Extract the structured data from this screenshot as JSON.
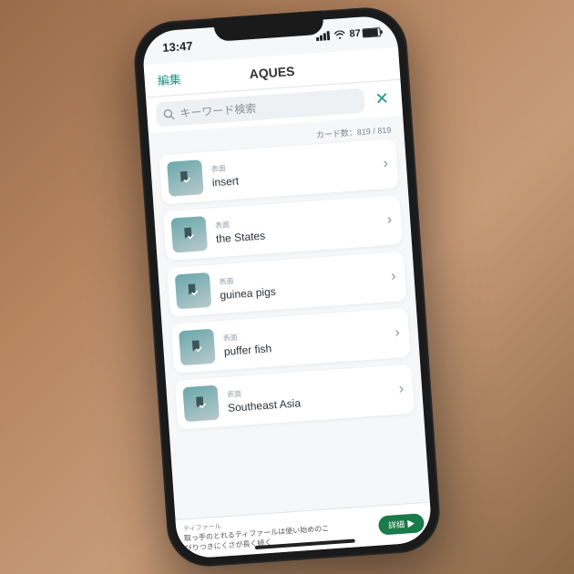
{
  "status": {
    "time": "13:47",
    "battery": "87"
  },
  "nav": {
    "edit": "編集",
    "title": "AQUES"
  },
  "search": {
    "placeholder": "キーワード検索"
  },
  "card_count": "カード数：819 / 819",
  "card_label": "表面",
  "cards": [
    {
      "title": "insert"
    },
    {
      "title": "the States"
    },
    {
      "title": "guinea pigs"
    },
    {
      "title": "puffer fish"
    },
    {
      "title": "Southeast Asia"
    }
  ],
  "ad": {
    "brand": "ティファール",
    "line1": "取っ手のとれるティファールは使い始めのこ",
    "line2": "びりつきにくさが長く続く",
    "button": "詳細 ▶"
  }
}
